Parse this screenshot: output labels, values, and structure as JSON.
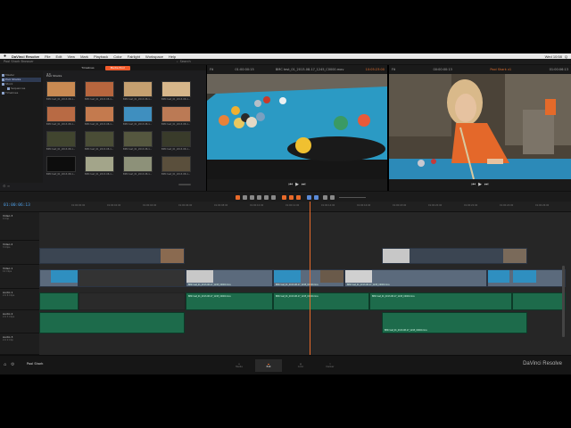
{
  "menubar": {
    "apple": "",
    "app": "DaVinci Resolve",
    "items": [
      "File",
      "Edit",
      "View",
      "Mark",
      "Playback",
      "Color",
      "Fairlight",
      "Workspace",
      "Help"
    ],
    "status": [
      "Wed 10:58",
      "Q"
    ]
  },
  "project": {
    "title": "Pool Shark Browser",
    "search_label": "Search"
  },
  "media_pool": {
    "tabs": [
      "Timelines",
      "Media Pool"
    ],
    "active_tab": 1,
    "current_bin": "Pool Sharks",
    "bins": [
      {
        "label": "Master",
        "selected": false,
        "sub": false
      },
      {
        "label": "Pool Sharks",
        "selected": true,
        "sub": false
      },
      {
        "label": "Stock",
        "selected": false,
        "sub": false
      },
      {
        "label": "Sequences",
        "selected": false,
        "sub": true
      },
      {
        "label": "Timelines",
        "selected": false,
        "sub": false
      }
    ],
    "clips": [
      {
        "caption": "BMC test_01_2013-08-1...",
        "color": "#c98a52"
      },
      {
        "caption": "BMC test_01_2013-08-1...",
        "color": "#b7663e"
      },
      {
        "caption": "BMC test_01_2013-08-1...",
        "color": "#c5a070"
      },
      {
        "caption": "BMC test_01_2013-08-1...",
        "color": "#d6b68a"
      },
      {
        "caption": "BMC test_01_2013-08-1...",
        "color": "#b86a44"
      },
      {
        "caption": "BMC test_01_2013-08-1...",
        "color": "#c47a4e"
      },
      {
        "caption": "BMC test_01_2013-08-1...",
        "color": "#3f8fbf"
      },
      {
        "caption": "BMC test_01_2013-08-1...",
        "color": "#bb7a55"
      },
      {
        "caption": "BMC test_01_2013-08-1...",
        "color": "#41452f"
      },
      {
        "caption": "BMC test_01_2013-08-1...",
        "color": "#4a4d36"
      },
      {
        "caption": "BMC test_01_2013-08-1...",
        "color": "#55573f"
      },
      {
        "caption": "BMC test_01_2013-08-1...",
        "color": "#393b2a"
      },
      {
        "caption": "BMC test_01_2013-08-1...",
        "color": "#0d0d0d"
      },
      {
        "caption": "BMC test_01_2013-08-1...",
        "color": "#a3a58a"
      },
      {
        "caption": "BMC test_01_2013-08-1...",
        "color": "#8d9179"
      },
      {
        "caption": "BMC test_01_2013-08-1...",
        "color": "#5a4f3c"
      }
    ]
  },
  "source_viewer": {
    "label": "Fit",
    "tc_in": "01:00:00:15",
    "clip_name": "BMC test_01_2013-08-17_1245_C0000.mov",
    "tc_out": "10:05:23:00"
  },
  "record_viewer": {
    "label": "Fit",
    "tc_in": "00:00:00:13",
    "timeline_name": "Pool Shark v1",
    "tc_out": "01:00:06:13"
  },
  "timeline": {
    "timecode": "01:00:06:13",
    "ruler_labels": [
      "01:00:00:00",
      "01:00:02:00",
      "01:00:04:00",
      "01:00:06:00",
      "01:00:08:00",
      "01:00:10:00",
      "01:00:12:00",
      "01:00:14:00",
      "01:00:16:00",
      "01:00:18:00",
      "01:00:20:00",
      "01:00:22:00",
      "01:00:24:00",
      "01:00:26:00",
      "01:00:28:00"
    ],
    "tracks": [
      {
        "name": "Video 3",
        "sub": "0 Clip"
      },
      {
        "name": "Video 2",
        "sub": "3 Clips"
      },
      {
        "name": "Video 1",
        "sub": "12 Clips"
      },
      {
        "name": "Audio 1",
        "sub": "2.0  6 Clips"
      },
      {
        "name": "Audio 2",
        "sub": "2.0  3 Clips"
      },
      {
        "name": "Audio 3",
        "sub": "2.0  0 Clip"
      }
    ],
    "clip_label": "BMC test_01_2013-08-17_1245_C0000.mov"
  },
  "pages": {
    "project_name": "Pool Shark",
    "tabs": [
      "Media",
      "Edit",
      "Color",
      "Deliver"
    ],
    "active": 1,
    "brand": "DaVinci Resolve"
  },
  "colors": {
    "accent": "#e86a2a",
    "video_clip": "#5b6a7c",
    "audio_clip": "#1d6b4b",
    "timecode": "#4fa0e8"
  }
}
